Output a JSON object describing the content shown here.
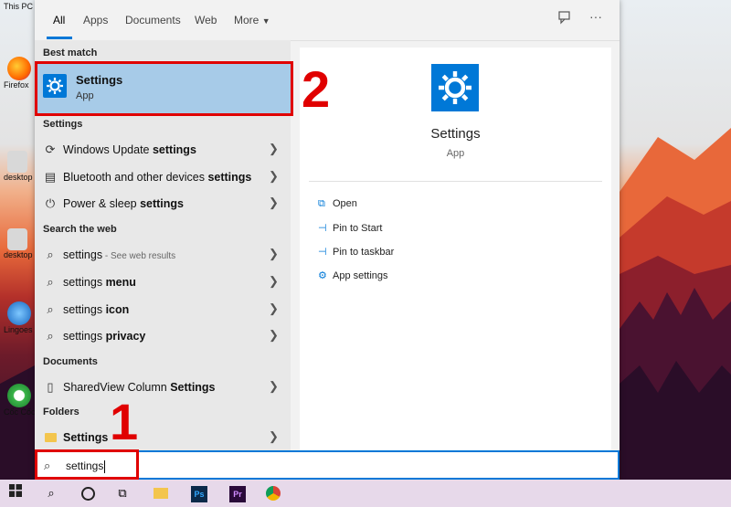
{
  "desktop": {
    "icons": [
      {
        "label": "This PC"
      },
      {
        "label": "Firefox"
      },
      {
        "label": "desktop"
      },
      {
        "label": "desktop"
      },
      {
        "label": "Lingoes"
      },
      {
        "label": "Cốc Cốc"
      }
    ]
  },
  "search_panel": {
    "tabs": [
      "All",
      "Apps",
      "Documents",
      "Web",
      "More"
    ],
    "best_match": {
      "section": "Best match",
      "title": "Settings",
      "subtitle": "App"
    },
    "settings_section": {
      "title": "Settings",
      "items": [
        {
          "prefix": "Windows Update ",
          "bold": "settings",
          "icon": "refresh-icon"
        },
        {
          "prefix": "Bluetooth and other devices ",
          "bold": "settings",
          "icon": "devices-icon"
        },
        {
          "prefix": "Power & sleep ",
          "bold": "settings",
          "icon": "power-icon"
        }
      ]
    },
    "web_section": {
      "title": "Search the web",
      "items": [
        {
          "prefix": "settings",
          "bold": "",
          "note": " - See web results"
        },
        {
          "prefix": "settings ",
          "bold": "menu",
          "note": ""
        },
        {
          "prefix": "settings ",
          "bold": "icon",
          "note": ""
        },
        {
          "prefix": "settings ",
          "bold": "privacy",
          "note": ""
        }
      ]
    },
    "documents_section": {
      "title": "Documents",
      "items": [
        {
          "prefix": "SharedView Column ",
          "bold": "Settings"
        }
      ]
    },
    "folders_section": {
      "title": "Folders",
      "items": [
        {
          "prefix": "",
          "bold": "Settings"
        }
      ]
    },
    "preview": {
      "title": "Settings",
      "subtitle": "App",
      "actions": [
        {
          "label": "Open",
          "icon": "open-icon"
        },
        {
          "label": "Pin to Start",
          "icon": "pin-icon"
        },
        {
          "label": "Pin to taskbar",
          "icon": "pin-icon"
        },
        {
          "label": "App settings",
          "icon": "gear-icon"
        }
      ]
    }
  },
  "search": {
    "value": "settings"
  },
  "annotations": {
    "step1": "1",
    "step2": "2"
  },
  "colors": {
    "accent": "#0078d7",
    "annotation": "#e00000",
    "selection": "#a7cbe8"
  }
}
